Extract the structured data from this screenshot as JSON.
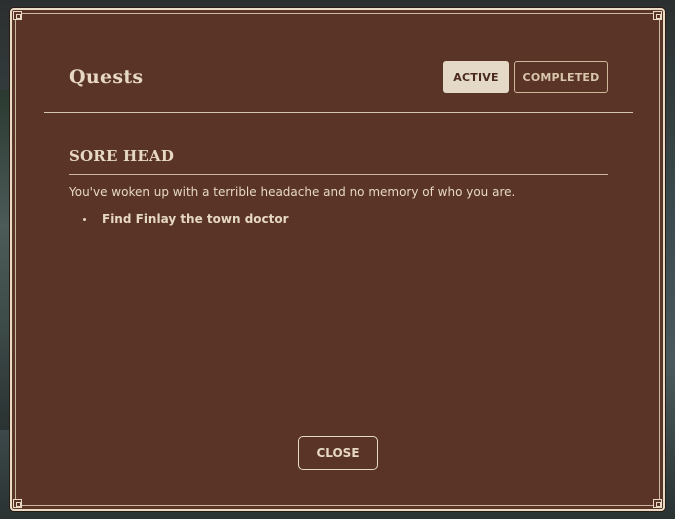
{
  "dialog": {
    "title": "Quests",
    "tabs": [
      {
        "label": "ACTIVE",
        "selected": true
      },
      {
        "label": "COMPLETED",
        "selected": false
      }
    ],
    "close_label": "CLOSE"
  },
  "quest": {
    "title": "SORE HEAD",
    "description": "You've woken up with a terrible headache and no memory of who you are.",
    "objectives": [
      "Find Finlay the town doctor"
    ]
  },
  "colors": {
    "panel_bg": "#5a3426",
    "border": "#e9dcc6",
    "text": "#e6d8c2",
    "active_tab_bg": "#e4d8c6"
  }
}
